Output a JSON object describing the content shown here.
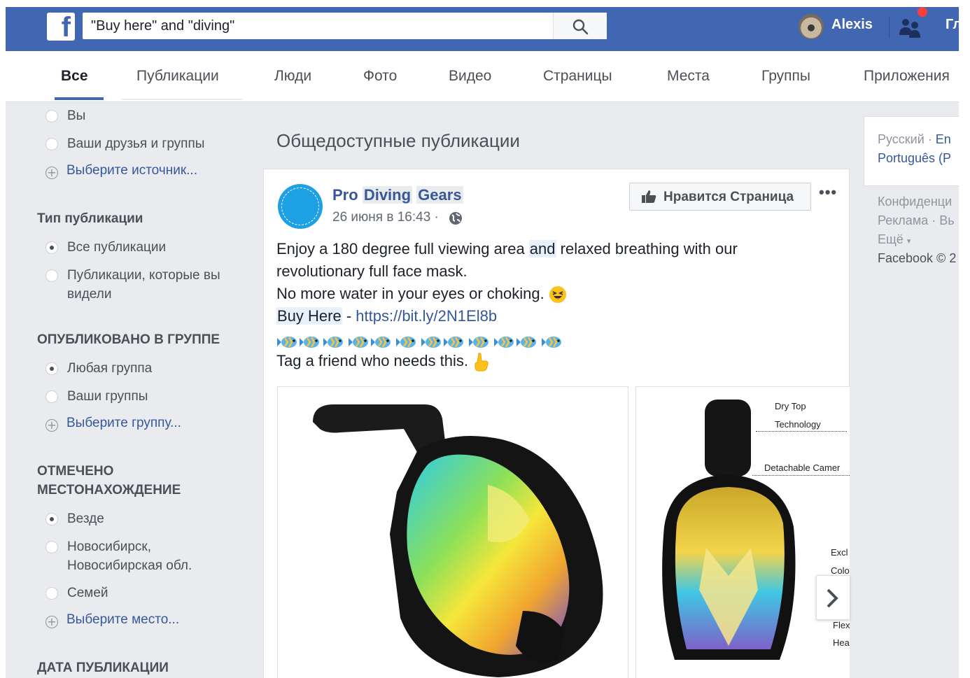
{
  "app": {
    "logo": "f",
    "brand_color": "#4267b2"
  },
  "search": {
    "value": "\"Buy here\" and \"diving\"",
    "icon": "search-icon"
  },
  "header": {
    "user_name": "Alexis",
    "home_label": "Гл"
  },
  "tabs": [
    {
      "label": "Все",
      "active": true
    },
    {
      "label": "Публикации"
    },
    {
      "label": "Люди"
    },
    {
      "label": "Фото"
    },
    {
      "label": "Видео"
    },
    {
      "label": "Страницы"
    },
    {
      "label": "Места"
    },
    {
      "label": "Группы"
    },
    {
      "label": "Приложения"
    }
  ],
  "filters": {
    "source_options": [
      "Вы",
      "Ваши друзья и группы"
    ],
    "source_choose": "Выберите источник...",
    "post_type_title": "Тип публикации",
    "post_type_options": [
      "Все публикации",
      "Публикации, которые вы видели"
    ],
    "group_title": "ОПУБЛИКОВАНО В ГРУППЕ",
    "group_options": [
      "Любая группа",
      "Ваши группы"
    ],
    "group_choose": "Выберите группу...",
    "location_title": "ОТМЕЧЕНО МЕСТОНАХОЖДЕНИЕ",
    "location_options": [
      "Везде",
      "Новосибирск, Новосибирская обл.",
      "Семей"
    ],
    "location_choose": "Выберите место...",
    "date_title": "ДАТА ПУБЛИКАЦИИ"
  },
  "main": {
    "heading": "Общедоступные публикации",
    "post": {
      "page_name_words": [
        "Pro",
        "Diving",
        "Gears"
      ],
      "date": "26 июня в 16:43 ·",
      "like_button": "Нравится Страница",
      "more": "•••",
      "line1_a": "Enjoy a 180 degree full viewing area ",
      "line1_b": "and",
      "line1_c": " relaxed breathing with our",
      "line2": "revolutionary full face mask.",
      "line3": "No more water in your eyes or choking.",
      "line4_a": "Buy Here",
      "line4_b": " - ",
      "line4_link": "https://bit.ly/2N1El8b",
      "line6": "Tag a friend who needs this.",
      "image2_annotations": [
        "Dry Top",
        "Technology",
        "Detachable Camer",
        "Excl",
        "Colo",
        "Flex",
        "Hea"
      ]
    }
  },
  "right": {
    "lang_1": "Русский",
    "lang_sep": " · ",
    "lang_2": "En",
    "lang_3": "Português (P",
    "footer_1": "Конфиденци",
    "footer_2a": "Реклама",
    "footer_2b": "Вь",
    "footer_3": "Ещё",
    "footer_4": "Facebook © 2"
  }
}
